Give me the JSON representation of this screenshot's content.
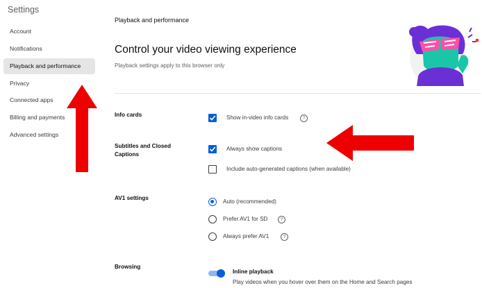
{
  "sidebar": {
    "title": "Settings",
    "items": [
      {
        "label": "Account"
      },
      {
        "label": "Notifications"
      },
      {
        "label": "Playback and performance"
      },
      {
        "label": "Privacy"
      },
      {
        "label": "Connected apps"
      },
      {
        "label": "Billing and payments"
      },
      {
        "label": "Advanced settings"
      }
    ],
    "active_index": 2
  },
  "main": {
    "section_heading": "Playback and performance",
    "title": "Control your video viewing experience",
    "subtitle": "Playback settings apply to this browser only"
  },
  "info_cards": {
    "label": "Info cards",
    "option": {
      "text": "Show in-video info cards",
      "checked": true,
      "help_icon": "?"
    }
  },
  "subtitles": {
    "label_line1": "Subtitles and Closed",
    "label_line2": "Captions",
    "options": [
      {
        "text": "Always show captions",
        "checked": true
      },
      {
        "text": "Include auto-generated captions (when available)",
        "checked": false
      }
    ]
  },
  "av1": {
    "label": "AV1 settings",
    "options": [
      {
        "text": "Auto (recommended)",
        "selected": true
      },
      {
        "text": "Prefer AV1 for SD",
        "selected": false,
        "help_icon": "?"
      },
      {
        "text": "Always prefer AV1",
        "selected": false,
        "help_icon": "?"
      }
    ]
  },
  "browsing": {
    "label": "Browsing",
    "toggle_title": "Inline playback",
    "toggle_desc": "Play videos when you hover over them on the Home and Search pages",
    "enabled": true
  },
  "colors": {
    "accent": "#065fd4",
    "active_bg": "#e5e5e5",
    "arrow": "#ee0000",
    "illustration_purple": "#6b2fd6",
    "illustration_teal": "#19c7a8",
    "illustration_pink": "#ff4ea8"
  }
}
